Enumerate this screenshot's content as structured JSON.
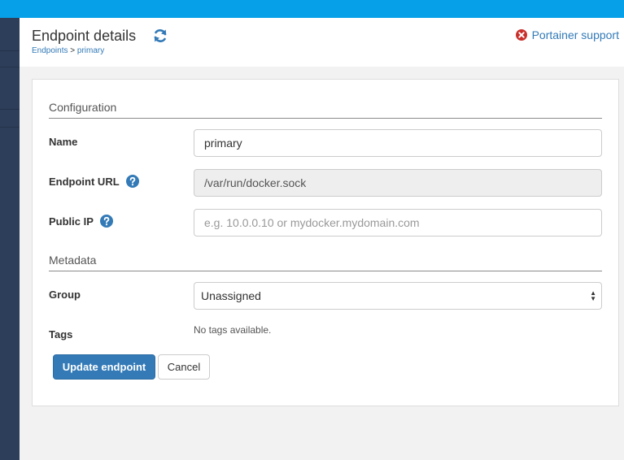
{
  "header": {
    "title": "Endpoint details",
    "breadcrumb": {
      "root": "Endpoints",
      "separator": ">",
      "current": "primary"
    },
    "support_label": "Portainer support"
  },
  "form": {
    "configuration_title": "Configuration",
    "name": {
      "label": "Name",
      "value": "primary"
    },
    "url": {
      "label": "Endpoint URL",
      "value": "/var/run/docker.sock"
    },
    "public_ip": {
      "label": "Public IP",
      "placeholder": "e.g. 10.0.0.10 or mydocker.mydomain.com"
    },
    "metadata_title": "Metadata",
    "group": {
      "label": "Group",
      "selected": "Unassigned"
    },
    "tags": {
      "label": "Tags",
      "empty_text": "No tags available."
    },
    "update_button": "Update endpoint",
    "cancel_button": "Cancel"
  },
  "icons": {
    "refresh": "refresh-icon",
    "support": "times-circle-icon",
    "help": "question-circle-icon"
  },
  "colors": {
    "topbar": "#06a0e9",
    "sidebar": "#2d3e5a",
    "link": "#337ab7",
    "primary_button": "#337ab7",
    "support_icon": "#c9302c"
  }
}
